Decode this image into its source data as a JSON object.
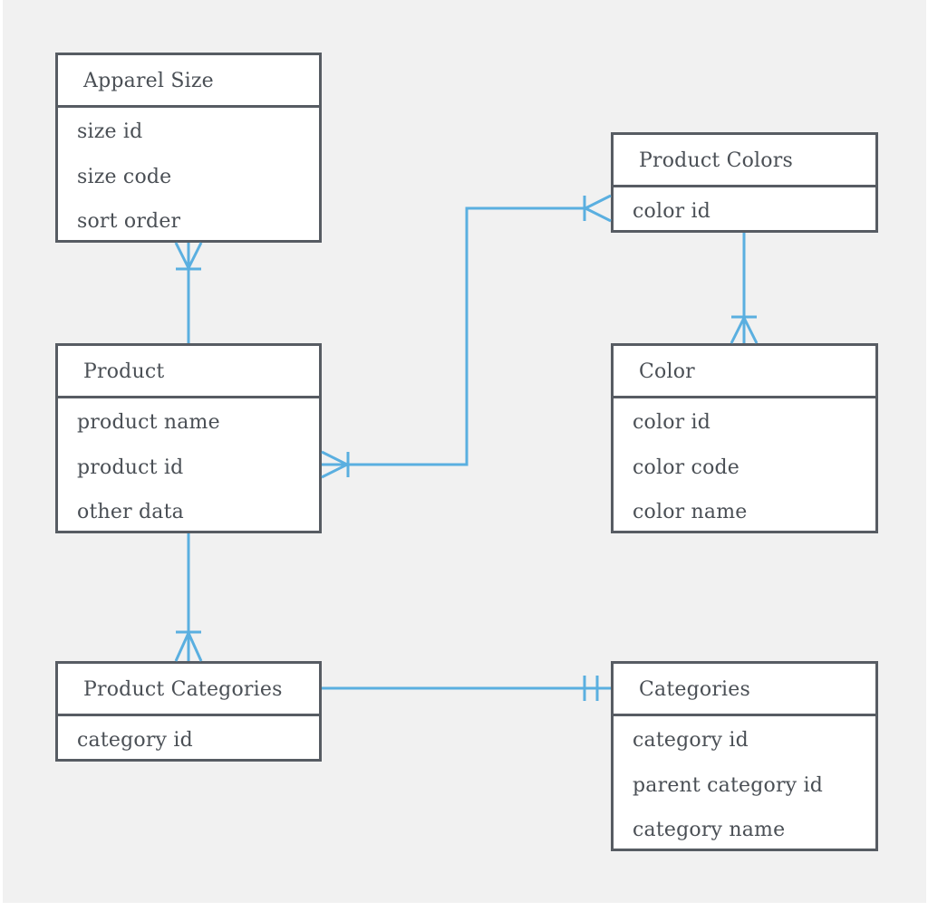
{
  "diagram": {
    "type": "entity-relationship",
    "colors": {
      "background": "#f1f1f1",
      "entity_border": "#575c63",
      "entity_fill": "#ffffff",
      "text": "#4a4f55",
      "relationship_line": "#5aafe0"
    },
    "entities": [
      {
        "id": "apparel_size",
        "title": "Apparel Size",
        "attributes": [
          "size id",
          "size code",
          "sort order"
        ]
      },
      {
        "id": "product_colors",
        "title": "Product Colors",
        "attributes": [
          "color id"
        ]
      },
      {
        "id": "product",
        "title": "Product",
        "attributes": [
          "product name",
          "product id",
          "other data"
        ]
      },
      {
        "id": "color",
        "title": "Color",
        "attributes": [
          "color id",
          "color code",
          "color name"
        ]
      },
      {
        "id": "product_categories",
        "title": "Product Categories",
        "attributes": [
          "category id"
        ]
      },
      {
        "id": "categories",
        "title": "Categories",
        "attributes": [
          "category id",
          "parent category id",
          "category name"
        ]
      }
    ],
    "relationships": [
      {
        "from": "product",
        "to": "apparel_size",
        "from_end": "none",
        "to_end": "one-or-many"
      },
      {
        "from": "product_colors",
        "to": "product",
        "from_end": "one-or-many",
        "to_end": "one-or-many"
      },
      {
        "from": "product_colors",
        "to": "color",
        "from_end": "none",
        "to_end": "one-or-many"
      },
      {
        "from": "product",
        "to": "product_categories",
        "from_end": "none",
        "to_end": "one-or-many"
      },
      {
        "from": "product_categories",
        "to": "categories",
        "from_end": "none",
        "to_end": "one-and-only-one"
      }
    ]
  }
}
